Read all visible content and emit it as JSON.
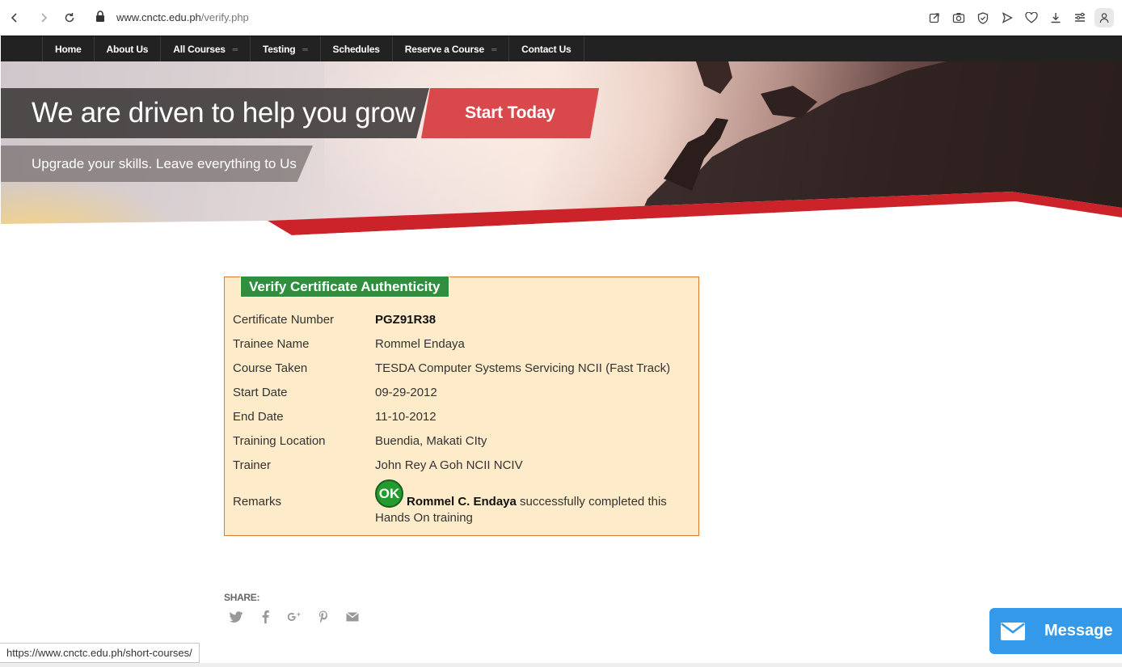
{
  "browser": {
    "url_domain": "www.cnctc.edu.ph",
    "url_path": "/verify.php",
    "status_url": "https://www.cnctc.edu.ph/short-courses/"
  },
  "nav": {
    "items": [
      {
        "label": "Home",
        "has_dropdown": false
      },
      {
        "label": "About Us",
        "has_dropdown": false
      },
      {
        "label": "All Courses",
        "has_dropdown": true
      },
      {
        "label": "Testing",
        "has_dropdown": true
      },
      {
        "label": "Schedules",
        "has_dropdown": false
      },
      {
        "label": "Reserve a Course",
        "has_dropdown": true
      },
      {
        "label": "Contact Us",
        "has_dropdown": false
      }
    ]
  },
  "hero": {
    "headline": "We are driven to help you grow",
    "cta_label": "Start Today",
    "subline": "Upgrade your skills. Leave everything to Us"
  },
  "certificate": {
    "title": "Verify Certificate Authenticity",
    "rows": [
      {
        "label": "Certificate Number",
        "value": "PGZ91R38"
      },
      {
        "label": "Trainee Name",
        "value": "Rommel Endaya"
      },
      {
        "label": "Course Taken",
        "value": "TESDA Computer Systems Servicing NCII (Fast Track)"
      },
      {
        "label": "Start Date",
        "value": "09-29-2012"
      },
      {
        "label": "End Date",
        "value": "11-10-2012"
      },
      {
        "label": "Training Location",
        "value": "Buendia, Makati CIty"
      },
      {
        "label": "Trainer",
        "value": "John Rey A Goh NCII NCIV"
      }
    ],
    "remarks_label": "Remarks",
    "ok_badge": "OK",
    "remarks_name": "Rommel C. Endaya",
    "remarks_text": " successfully completed this Hands On training"
  },
  "share": {
    "label": "SHARE:",
    "icons": [
      "twitter-icon",
      "facebook-icon",
      "google-plus-icon",
      "pinterest-icon",
      "email-icon"
    ]
  },
  "message_button": {
    "label": "Message"
  },
  "colors": {
    "nav_bg": "#222222",
    "cta_red": "#d9484b",
    "cert_bg": "#feebc9",
    "cert_border": "#e17b2f",
    "cert_title_bg": "#2f8f3f",
    "message_bg": "#3399e8",
    "swoosh_red": "#cc2229"
  }
}
